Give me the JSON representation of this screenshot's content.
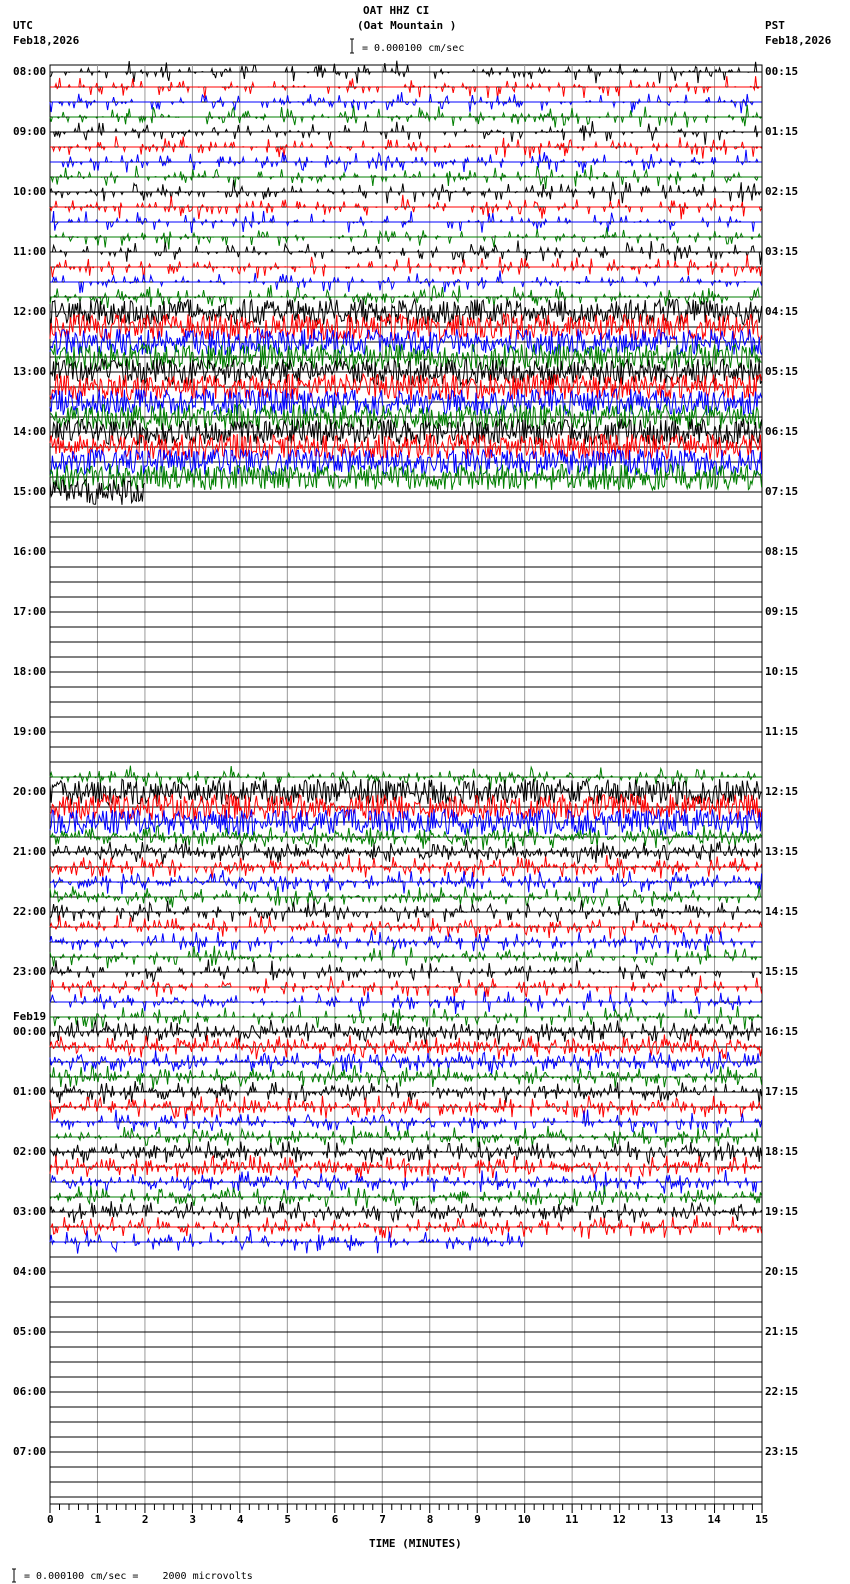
{
  "header": {
    "title": "OAT HHZ CI",
    "subtitle": "(Oat Mountain )",
    "left_tz": "UTC",
    "left_date": "Feb18,2026",
    "right_tz": "PST",
    "right_date": "Feb18,2026",
    "scale": "= 0.000100 cm/sec"
  },
  "footer": {
    "scale": "= 0.000100 cm/sec =    2000 microvolts"
  },
  "chart_data": {
    "type": "line",
    "title": "OAT HHZ CI (Oat Mountain )",
    "xlabel": "TIME (MINUTES)",
    "xlim": [
      0,
      15
    ],
    "x_ticks": [
      "0",
      "1",
      "2",
      "3",
      "4",
      "5",
      "6",
      "7",
      "8",
      "9",
      "10",
      "11",
      "12",
      "13",
      "14",
      "15"
    ],
    "utc_labels": [
      "08:00",
      "09:00",
      "10:00",
      "11:00",
      "12:00",
      "13:00",
      "14:00",
      "15:00",
      "16:00",
      "17:00",
      "18:00",
      "19:00",
      "20:00",
      "21:00",
      "22:00",
      "23:00",
      "00:00",
      "01:00",
      "02:00",
      "03:00",
      "04:00",
      "05:00",
      "06:00",
      "07:00"
    ],
    "pst_labels": [
      "00:15",
      "01:15",
      "02:15",
      "03:15",
      "04:15",
      "05:15",
      "06:15",
      "07:15",
      "08:15",
      "09:15",
      "10:15",
      "11:15",
      "12:15",
      "13:15",
      "14:15",
      "15:15",
      "16:15",
      "17:15",
      "18:15",
      "19:15",
      "20:15",
      "21:15",
      "22:15",
      "23:15"
    ],
    "date_change_label": "Feb19",
    "trace_colors": [
      "#000000",
      "#ff0000",
      "#0000ff",
      "#007f00"
    ],
    "traces_per_hour": 4,
    "trace_activity": [
      0.3,
      0.25,
      0.3,
      0.35,
      0.3,
      0.35,
      0.35,
      0.3,
      0.35,
      0.3,
      0.25,
      0.3,
      0.3,
      0.3,
      0.3,
      0.4,
      1,
      1,
      1,
      1,
      1,
      1,
      1,
      1,
      1,
      1,
      1,
      1,
      0.9,
      0,
      0,
      0,
      0,
      0,
      0,
      0,
      0,
      0,
      0,
      0,
      0,
      0,
      0,
      0,
      0,
      0,
      0,
      0.35,
      1,
      1,
      0.9,
      0.8,
      0.8,
      0.6,
      0.6,
      0.5,
      0.5,
      0.45,
      0.45,
      0.4,
      0.4,
      0.35,
      0.35,
      0.35,
      0.8,
      0.8,
      0.7,
      0.6,
      0.6,
      0.55,
      0.5,
      0.5,
      0.7,
      0.7,
      0.6,
      0.55,
      0.6,
      0.5,
      0.5,
      0,
      0,
      0,
      0,
      0,
      0,
      0,
      0,
      0,
      0,
      0,
      0,
      0,
      0,
      0,
      0,
      0
    ],
    "trace_end_minute": {
      "28": 2,
      "78": 10
    }
  }
}
